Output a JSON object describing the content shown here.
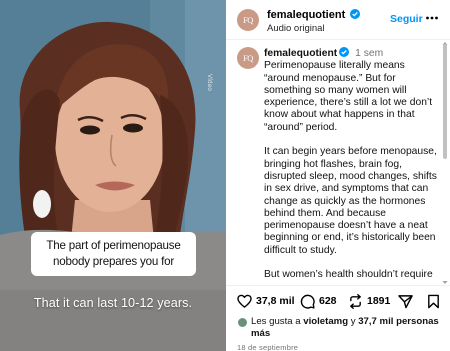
{
  "video": {
    "watermark": "Vídeo",
    "caption_box": "The part of perimenopause nobody prepares you for",
    "subtitle": "That it can last 10-12 years."
  },
  "header": {
    "avatar_initials": "FQ",
    "username": "femalequotient",
    "audio": "Audio original",
    "follow_label": "Seguir",
    "more_icon": "more-horizontal-icon"
  },
  "caption": {
    "avatar_initials": "FQ",
    "username": "femalequotient",
    "time": "1 sem",
    "paragraph1": "Perimenopause literally means “around menopause.” But for something so many women will experience, there’s still a lot we don’t know about what happens in that “around” period.",
    "paragraph2": "It can begin years before menopause, bringing hot flashes, brain fog, disrupted sleep, mood changes, shifts in sex drive, and symptoms that can change as quickly as the hormones behind them. And because perimenopause doesn’t have a neat beginning or end, it’s historically been difficult to study.",
    "paragraph3": "But women’s health shouldn’t require"
  },
  "actions": {
    "likes_count": "37,8 mil",
    "comments_count": "628",
    "reposts_count": "1891",
    "icons": [
      "heart-icon",
      "comment-icon",
      "repost-icon",
      "share-icon",
      "bookmark-icon"
    ]
  },
  "likes": {
    "prefix": "Les gusta a ",
    "user": "violetamg",
    "middle": " y ",
    "others": "37,7 mil personas más"
  },
  "date": "18 de septiembre",
  "colors": {
    "accent_blue": "#0095f6",
    "secondary_text": "#737373",
    "avatar_bg": "#c99b86"
  }
}
